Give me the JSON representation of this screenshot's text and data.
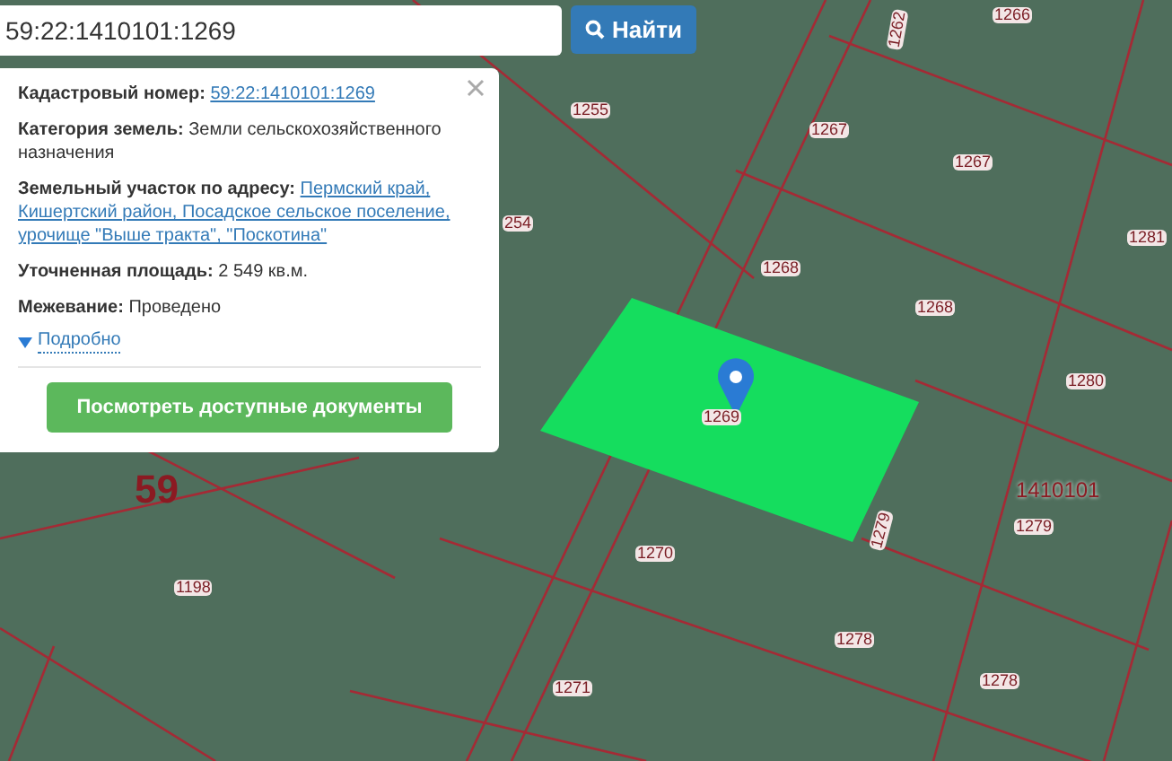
{
  "search": {
    "value": "59:22:1410101:1269",
    "button": "Найти"
  },
  "info_panel": {
    "rows": [
      {
        "kind": "link",
        "label": "Кадастровый номер:",
        "lines": [
          "59:22:1410101:1269"
        ]
      },
      {
        "kind": "text",
        "label": "Категория земель:",
        "lines": [
          "Земли сельскохозяйственного назначения"
        ]
      },
      {
        "kind": "link",
        "label": "Земельный участок по адресу:",
        "lines": [
          "Пермский край,",
          "Кишертский район, Посадское сельское поселение,",
          "урочище \"Выше тракта\", \"Поскотина\""
        ]
      },
      {
        "kind": "text",
        "label": "Уточненная площадь:",
        "lines": [
          "2 549 кв.м."
        ]
      },
      {
        "kind": "text",
        "label": "Межевание:",
        "lines": [
          "Проведено"
        ]
      }
    ],
    "details": {
      "label": "Подробно",
      "expanded": false
    },
    "button": "Посмотреть доступные документы"
  },
  "map": {
    "labels": [
      {
        "kind": "parcel",
        "text": "1266"
      },
      {
        "kind": "parcel",
        "text": "1262"
      },
      {
        "kind": "parcel",
        "text": "1255"
      },
      {
        "kind": "parcel",
        "text": "1267"
      },
      {
        "kind": "parcel",
        "text": "1267"
      },
      {
        "kind": "parcel",
        "text": "254"
      },
      {
        "kind": "parcel",
        "text": "1281"
      },
      {
        "kind": "parcel",
        "text": "1268"
      },
      {
        "kind": "parcel",
        "text": "1268"
      },
      {
        "kind": "parcel",
        "text": "1280"
      },
      {
        "kind": "parcel",
        "text": "1269"
      },
      {
        "kind": "region",
        "text": "59"
      },
      {
        "kind": "district",
        "text": "1410101"
      },
      {
        "kind": "parcel",
        "text": "1279"
      },
      {
        "kind": "parcel",
        "text": "1279"
      },
      {
        "kind": "parcel",
        "text": "1198"
      },
      {
        "kind": "parcel",
        "text": "1270"
      },
      {
        "kind": "parcel",
        "text": "1278"
      },
      {
        "kind": "parcel",
        "text": "1278"
      },
      {
        "kind": "parcel",
        "text": "1271"
      }
    ]
  }
}
